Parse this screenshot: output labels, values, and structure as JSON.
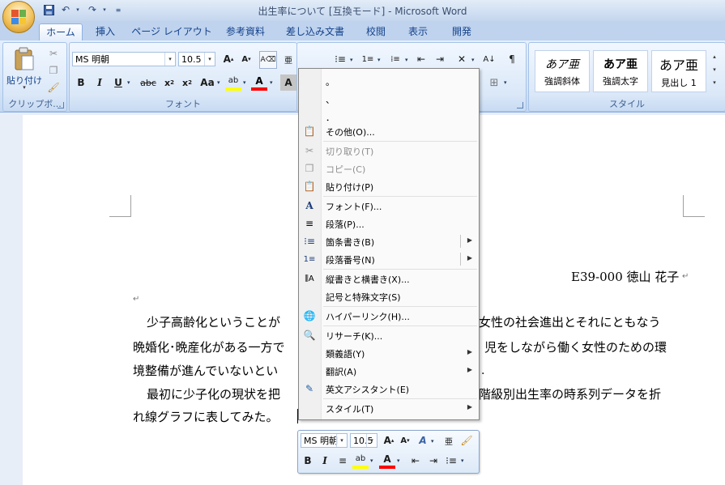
{
  "window": {
    "title": "出生率について [互換モード] - Microsoft Word"
  },
  "tabs": [
    {
      "label": "ホーム"
    },
    {
      "label": "挿入"
    },
    {
      "label": "ページ レイアウト"
    },
    {
      "label": "参考資料"
    },
    {
      "label": "差し込み文書"
    },
    {
      "label": "校閲"
    },
    {
      "label": "表示"
    },
    {
      "label": "開発"
    }
  ],
  "ribbon": {
    "clipboard": {
      "label": "クリップボ...",
      "paste_label": "貼り付け"
    },
    "font": {
      "label": "フォント",
      "font_name": "MS 明朝",
      "font_size": "10.5",
      "aa_label": "Aa",
      "abc_label": "abc"
    },
    "styles": {
      "label": "スタイル",
      "items": [
        {
          "sample": "あア亜",
          "name": "強調斜体"
        },
        {
          "sample": "あア亜",
          "name": "強調太字"
        },
        {
          "sample": "あア亜",
          "name": "見出し 1"
        }
      ]
    }
  },
  "document": {
    "author_line": "E39-000 徳山 花子",
    "lines": [
      "少子高齢化ということが",
      "女性の社会進出とそれにともなう",
      "晩婚化･晩産化がある一方で",
      "児をしながら働く女性のための環",
      "境整備が進んでいないとい",
      "最初に少子化の現状を把",
      "階級別出生率の時系列データを折",
      "れ線グラフに表してみた。"
    ]
  },
  "context_menu": {
    "symbols": [
      "。",
      "、",
      "．"
    ],
    "items": [
      {
        "label": "その他(O)...",
        "icon": "omega-symbol-icon"
      },
      {
        "label": "切り取り(T)",
        "icon": "scissors-icon"
      },
      {
        "label": "コピー(C)",
        "icon": "copy-icon"
      },
      {
        "label": "貼り付け(P)",
        "icon": "paste-icon"
      },
      {
        "label": "フォント(F)...",
        "icon": "font-icon"
      },
      {
        "label": "段落(P)...",
        "icon": "paragraph-icon"
      },
      {
        "label": "箇条書き(B)",
        "icon": "bullets-icon"
      },
      {
        "label": "段落番号(N)",
        "icon": "numbering-icon"
      },
      {
        "label": "縦書きと横書き(X)...",
        "icon": "text-direction-icon"
      },
      {
        "label": "記号と特殊文字(S)",
        "icon": ""
      },
      {
        "label": "ハイパーリンク(H)...",
        "icon": "hyperlink-icon"
      },
      {
        "label": "リサーチ(K)...",
        "icon": "research-icon"
      },
      {
        "label": "類義語(Y)",
        "icon": ""
      },
      {
        "label": "翻訳(A)",
        "icon": ""
      },
      {
        "label": "英文アシスタント(E)",
        "icon": "english-assistant-icon"
      },
      {
        "label": "スタイル(T)",
        "icon": ""
      }
    ]
  },
  "mini_toolbar": {
    "font_name": "MS 明朝",
    "font_size": "10.5"
  },
  "colors": {
    "accent": "#15428b",
    "highlight": "#ffff00",
    "font_color": "#ff0000"
  }
}
